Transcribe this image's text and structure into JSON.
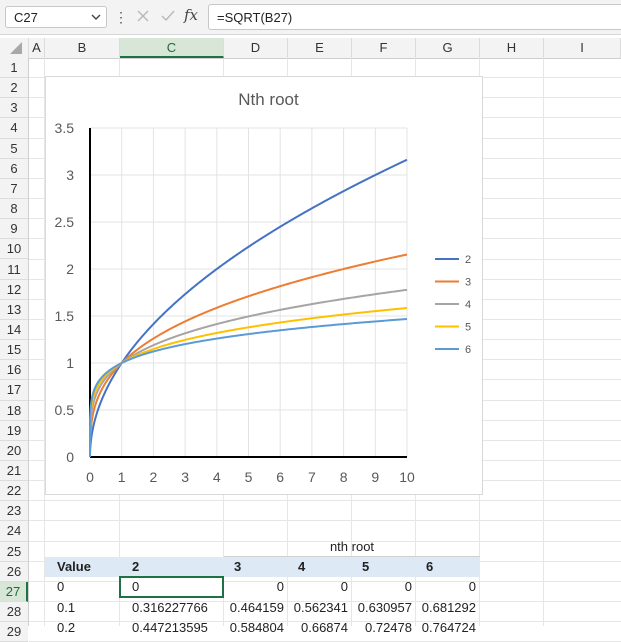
{
  "name_box": "C27",
  "formula": "=SQRT(B27)",
  "columns": [
    "A",
    "B",
    "C",
    "D",
    "E",
    "F",
    "G",
    "H",
    "I"
  ],
  "selected_column": "C",
  "rows": [
    "1",
    "2",
    "3",
    "4",
    "5",
    "6",
    "7",
    "8",
    "9",
    "10",
    "11",
    "12",
    "13",
    "14",
    "15",
    "16",
    "17",
    "18",
    "19",
    "20",
    "21",
    "22",
    "23",
    "24",
    "25",
    "26",
    "27",
    "28",
    "29"
  ],
  "selected_row": "27",
  "colors": {
    "accent": "#1e7145",
    "header_fill": "#dde9f5",
    "series": [
      "#4472c4",
      "#ed7d31",
      "#a5a5a5",
      "#ffc000",
      "#5b9bd5"
    ]
  },
  "chart_data": {
    "type": "line",
    "title": "Nth root",
    "x_ticks": [
      "0",
      "1",
      "2",
      "3",
      "4",
      "5",
      "6",
      "7",
      "8",
      "9",
      "10"
    ],
    "y_ticks": [
      "0",
      "0.5",
      "1",
      "1.5",
      "2",
      "2.5",
      "3",
      "3.5"
    ],
    "xlim": [
      0,
      10
    ],
    "ylim": [
      0,
      3.5
    ],
    "grid": true,
    "legend_position": "right",
    "series": [
      {
        "name": "2",
        "root": 2,
        "color": "#4472c4"
      },
      {
        "name": "3",
        "root": 3,
        "color": "#ed7d31"
      },
      {
        "name": "4",
        "root": 4,
        "color": "#a5a5a5"
      },
      {
        "name": "5",
        "root": 5,
        "color": "#ffc000"
      },
      {
        "name": "6",
        "root": 6,
        "color": "#5b9bd5"
      }
    ]
  },
  "table": {
    "group_header": "nth root",
    "headers": [
      "Value",
      "2",
      "3",
      "4",
      "5",
      "6"
    ],
    "rows": [
      [
        "0",
        "0",
        "0",
        "0",
        "0",
        "0"
      ],
      [
        "0.1",
        "0.316227766",
        "0.464159",
        "0.562341",
        "0.630957",
        "0.681292"
      ],
      [
        "0.2",
        "0.447213595",
        "0.584804",
        "0.66874",
        "0.72478",
        "0.764724"
      ]
    ]
  }
}
